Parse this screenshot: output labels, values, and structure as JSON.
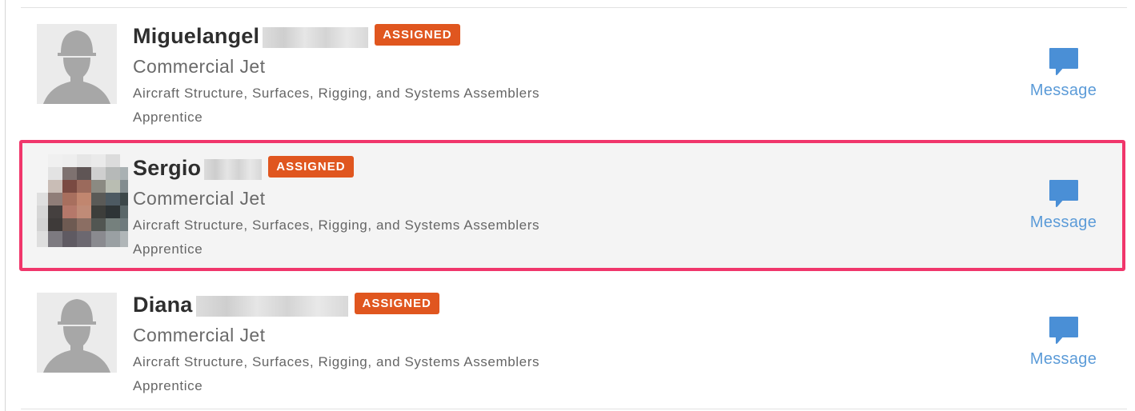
{
  "workers": [
    {
      "name": "Miguelangel",
      "status": "ASSIGNED",
      "company": "Commercial Jet",
      "trade": "Aircraft Structure, Surfaces, Rigging, and Systems Assemblers",
      "level": "Apprentice",
      "message_label": "Message",
      "avatar": "default-silhouette",
      "highlighted": false
    },
    {
      "name": "Sergio",
      "status": "ASSIGNED",
      "company": "Commercial Jet",
      "trade": "Aircraft Structure, Surfaces, Rigging, and Systems Assemblers",
      "level": "Apprentice",
      "message_label": "Message",
      "avatar": "pixelated-photo",
      "highlighted": true
    },
    {
      "name": "Diana",
      "status": "ASSIGNED",
      "company": "Commercial Jet",
      "trade": "Aircraft Structure, Surfaces, Rigging, and Systems Assemblers",
      "level": "Apprentice",
      "message_label": "Message",
      "avatar": "default-silhouette",
      "highlighted": false
    }
  ],
  "colors": {
    "badge": "#e0561f",
    "highlight_border": "#f0366b",
    "message_blue": "#5b9bd8"
  },
  "icons": {
    "message": "speech-bubble-icon",
    "avatar": "person-silhouette-icon"
  }
}
